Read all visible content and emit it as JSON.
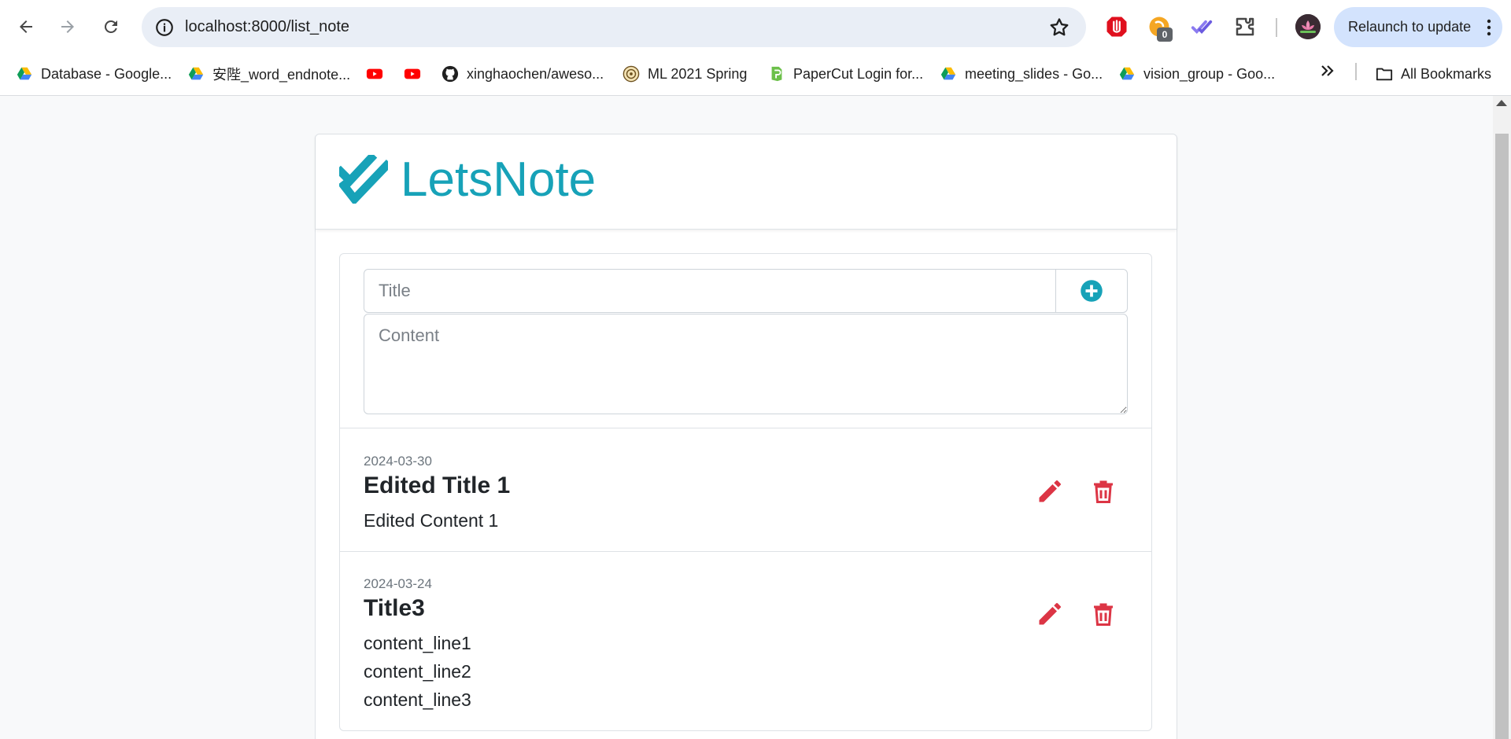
{
  "browser": {
    "url": "localhost:8000/list_note",
    "extension_badge": "0",
    "relaunch_label": "Relaunch to update",
    "bookmarks": [
      {
        "label": "Database - Google...",
        "icon": "google-drive-icon"
      },
      {
        "label": "安陛_word_endnote...",
        "icon": "google-drive-icon"
      },
      {
        "label": "",
        "icon": "youtube-icon"
      },
      {
        "label": "",
        "icon": "youtube-icon"
      },
      {
        "label": "xinghaochen/aweso...",
        "icon": "github-icon"
      },
      {
        "label": "ML 2021 Spring",
        "icon": "seal-icon"
      },
      {
        "label": "PaperCut Login for...",
        "icon": "papercut-icon"
      },
      {
        "label": "meeting_slides - Go...",
        "icon": "google-drive-icon"
      },
      {
        "label": "vision_group - Goo...",
        "icon": "google-drive-icon"
      }
    ],
    "all_bookmarks_label": "All Bookmarks"
  },
  "app": {
    "brand": "LetsNote",
    "brand_color": "#17a2b8",
    "action_color": "#dc3545"
  },
  "form": {
    "title_placeholder": "Title",
    "content_placeholder": "Content"
  },
  "notes": [
    {
      "date": "2024-03-30",
      "title": "Edited Title 1",
      "lines": [
        "Edited Content 1"
      ]
    },
    {
      "date": "2024-03-24",
      "title": "Title3",
      "lines": [
        "content_line1",
        "content_line2",
        "content_line3"
      ]
    }
  ]
}
